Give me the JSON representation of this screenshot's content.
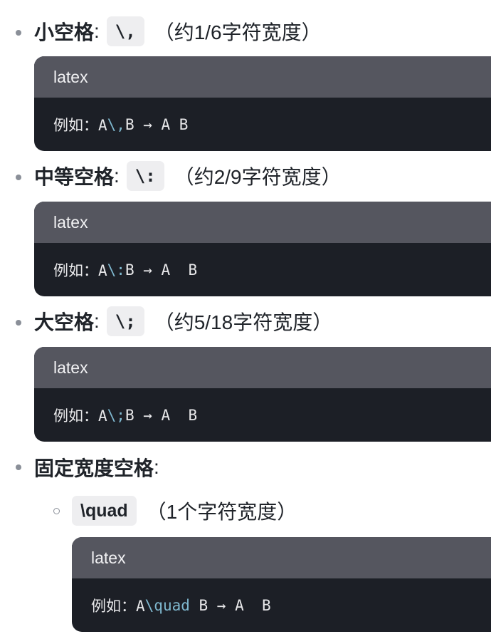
{
  "items": [
    {
      "term": "小空格",
      "colon": ":",
      "code": "\\,",
      "desc": "（约1/6字符宽度）",
      "block": {
        "lang": "latex",
        "prefix": "例如：A",
        "cmd": "\\,",
        "suffix": "B → A B"
      }
    },
    {
      "term": "中等空格",
      "colon": ":",
      "code": "\\:",
      "desc": "（约2/9字符宽度）",
      "block": {
        "lang": "latex",
        "prefix": "例如：A",
        "cmd": "\\:",
        "suffix": "B → A  B"
      }
    },
    {
      "term": "大空格",
      "colon": ":",
      "code": "\\;",
      "desc": "（约5/18字符宽度）",
      "block": {
        "lang": "latex",
        "prefix": "例如：A",
        "cmd": "\\;",
        "suffix": "B → A  B"
      }
    },
    {
      "term": "固定宽度空格",
      "colon": ":"
    }
  ],
  "subitems": [
    {
      "code": "\\quad",
      "desc": "（1个字符宽度）",
      "block": {
        "lang": "latex",
        "prefix": "例如：A",
        "cmd": "\\quad",
        "suffix": " B → A  B"
      }
    }
  ]
}
